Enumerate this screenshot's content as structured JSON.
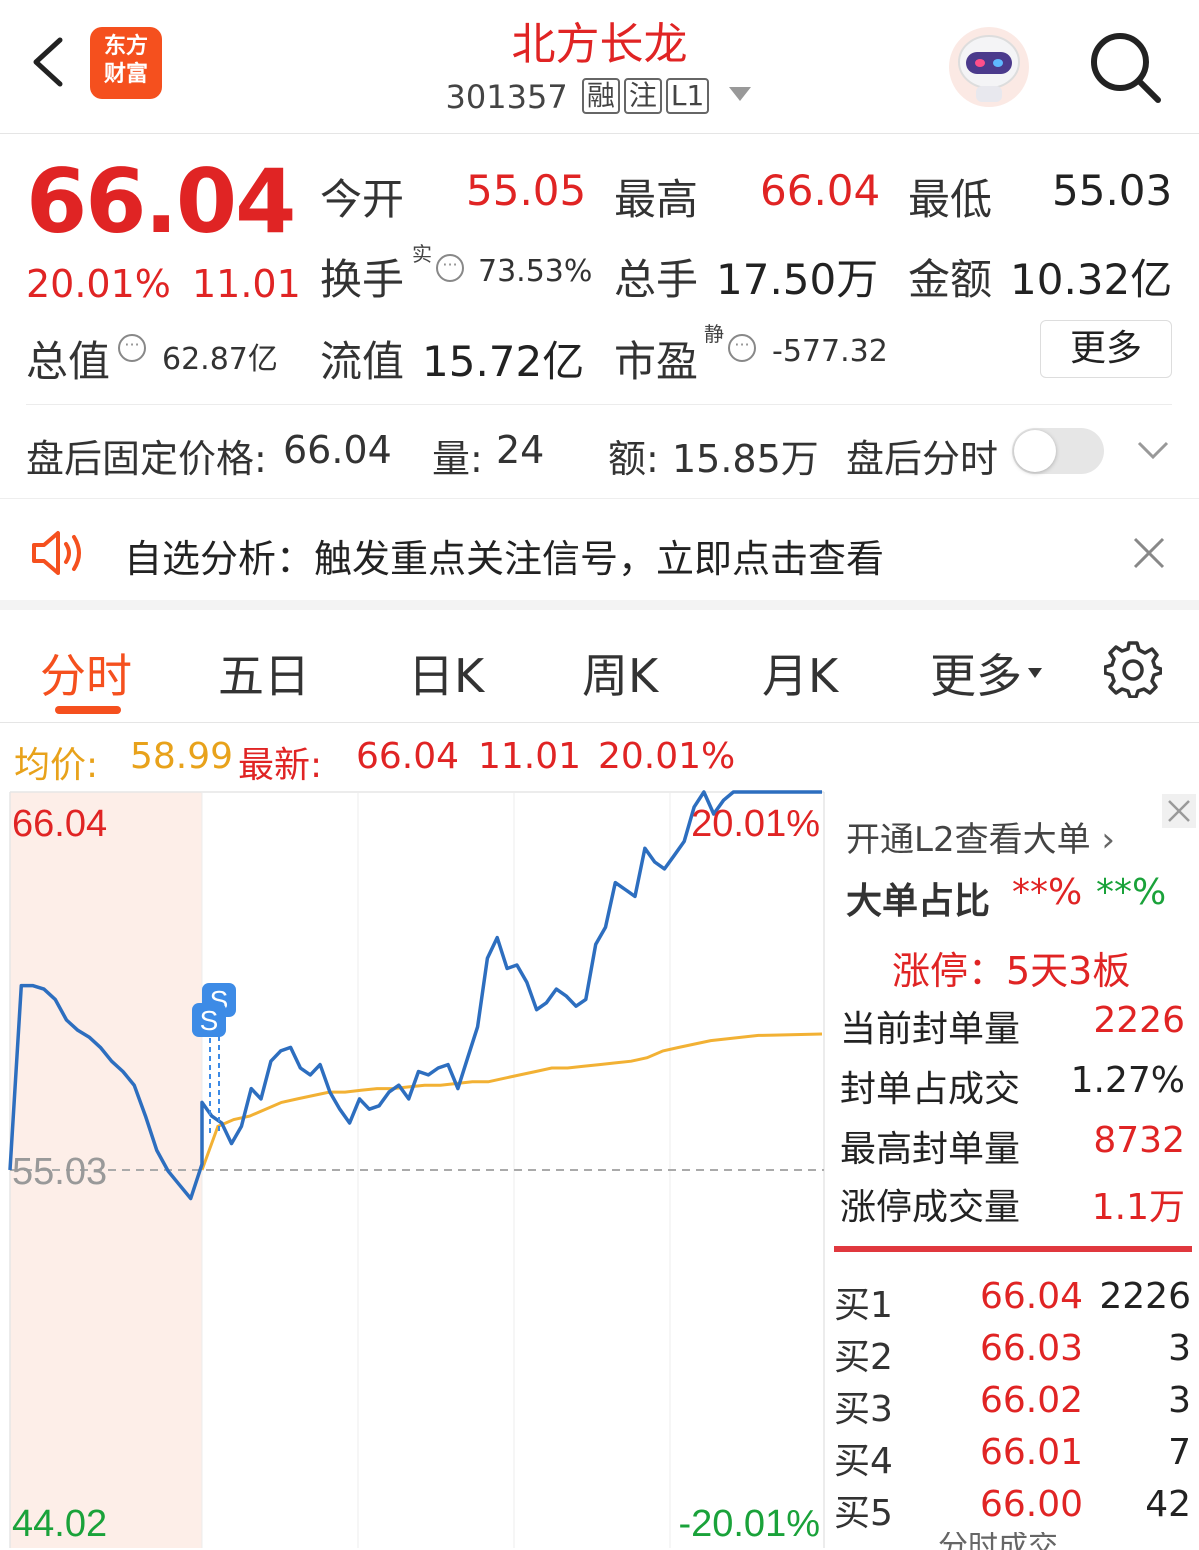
{
  "header": {
    "logo_line1": "东方",
    "logo_line2": "财富",
    "title": "北方长龙",
    "code": "301357",
    "tags": [
      "融",
      "注",
      "L1"
    ]
  },
  "quote": {
    "price": "66.04",
    "change_pct": "20.01%",
    "change_amt": "11.01",
    "open_label": "今开",
    "open": "55.05",
    "high_label": "最高",
    "high": "66.04",
    "low_label": "最低",
    "low": "55.03",
    "turnover_label": "换手",
    "turnover_sup": "实",
    "turnover": "73.53%",
    "volume_label": "总手",
    "volume": "17.50万",
    "amount_label": "金额",
    "amount": "10.32亿",
    "mktcap_label": "总值",
    "mktcap": "62.87亿",
    "float_label": "流值",
    "float": "15.72亿",
    "pe_label": "市盈",
    "pe_sup": "静",
    "pe": "-577.32",
    "more": "更多"
  },
  "after_hours": {
    "price_label": "盘后固定价格:",
    "price": "66.04",
    "vol_label": "量:",
    "vol": "24",
    "amt_label": "额:",
    "amt": "15.85万",
    "toggle_label": "盘后分时"
  },
  "notice": {
    "text": "自选分析：触发重点关注信号，立即点击查看"
  },
  "tabs": [
    "分时",
    "五日",
    "日K",
    "周K",
    "月K",
    "更多"
  ],
  "info": {
    "avg_label": "均价:",
    "avg": "58.99",
    "latest_label": "最新:",
    "latest": "66.04",
    "chg": "11.01",
    "pct": "20.01%"
  },
  "chart_data": {
    "type": "line",
    "y_top_label": "66.04",
    "y_mid_label": "55.03",
    "y_bottom_label": "44.02",
    "pct_top_label": "20.01%",
    "pct_bottom_label": "-20.01%",
    "ylim": [
      44.02,
      66.04
    ],
    "prev_close": 55.03,
    "marker_label": "S",
    "series": [
      {
        "values": [
          55.03,
          60.4,
          60.4,
          60.3,
          60.0,
          59.4,
          59.1,
          58.9,
          58.6,
          58.2,
          57.9,
          57.5,
          56.6,
          55.6,
          55.0,
          54.6,
          54.2,
          55.2,
          57.0,
          56.6,
          56.4,
          55.8,
          56.3,
          57.4,
          57.1,
          58.2,
          58.5,
          58.6,
          58.0,
          57.8,
          58.1,
          57.3,
          56.8,
          56.4,
          57.1,
          56.8,
          56.9,
          57.3,
          57.5,
          57.1,
          57.9,
          57.8,
          58.0,
          58.1,
          57.4,
          58.3,
          59.2,
          61.2,
          61.8,
          60.9,
          61.0,
          60.5,
          59.7,
          59.9,
          60.3,
          60.1,
          59.8,
          60.0,
          61.6,
          62.1,
          63.4,
          63.2,
          63.0,
          64.4,
          64.0,
          63.8,
          64.2,
          64.6,
          65.6,
          66.04,
          65.4,
          65.8,
          66.04,
          66.04,
          66.04,
          66.04,
          66.04,
          66.04,
          66.04,
          66.04,
          66.04,
          66.04
        ]
      },
      {
        "values": [
          55.03,
          56.3,
          56.5,
          56.6,
          56.8,
          57.0,
          57.1,
          57.2,
          57.3,
          57.3,
          57.35,
          57.4,
          57.4,
          57.45,
          57.5,
          57.5,
          57.55,
          57.6,
          57.6,
          57.7,
          57.8,
          57.9,
          58.0,
          58.0,
          58.05,
          58.1,
          58.15,
          58.2,
          58.3,
          58.5,
          58.6,
          58.7,
          58.8,
          58.85,
          58.9,
          58.95,
          58.96,
          58.97,
          58.98,
          58.99
        ]
      }
    ]
  },
  "panel": {
    "l2_text": "开通L2查看大单",
    "big_order_label": "大单占比",
    "big_order_buy": "**%",
    "big_order_sell": "**%",
    "limit_label": "涨停：5天3板",
    "rows": [
      {
        "label": "当前封单量",
        "value": "2226",
        "color": "#e02424"
      },
      {
        "label": "封单占成交",
        "value": "1.27%",
        "color": "#222222"
      },
      {
        "label": "最高封单量",
        "value": "8732",
        "color": "#e02424"
      },
      {
        "label": "涨停成交量",
        "value": "1.1万",
        "color": "#e02424"
      }
    ],
    "orderbook": [
      {
        "label": "买1",
        "price": "66.04",
        "vol": "2226"
      },
      {
        "label": "买2",
        "price": "66.03",
        "vol": "3"
      },
      {
        "label": "买3",
        "price": "66.02",
        "vol": "3"
      },
      {
        "label": "买4",
        "price": "66.01",
        "vol": "7"
      },
      {
        "label": "买5",
        "price": "66.00",
        "vol": "42"
      }
    ],
    "bottom_cut": "分时成交"
  },
  "colors": {
    "up": "#e02424",
    "down": "#1aa23a",
    "price_line": "#2d6ebf",
    "avg_line": "#f2b134",
    "accent": "#f5501e"
  }
}
